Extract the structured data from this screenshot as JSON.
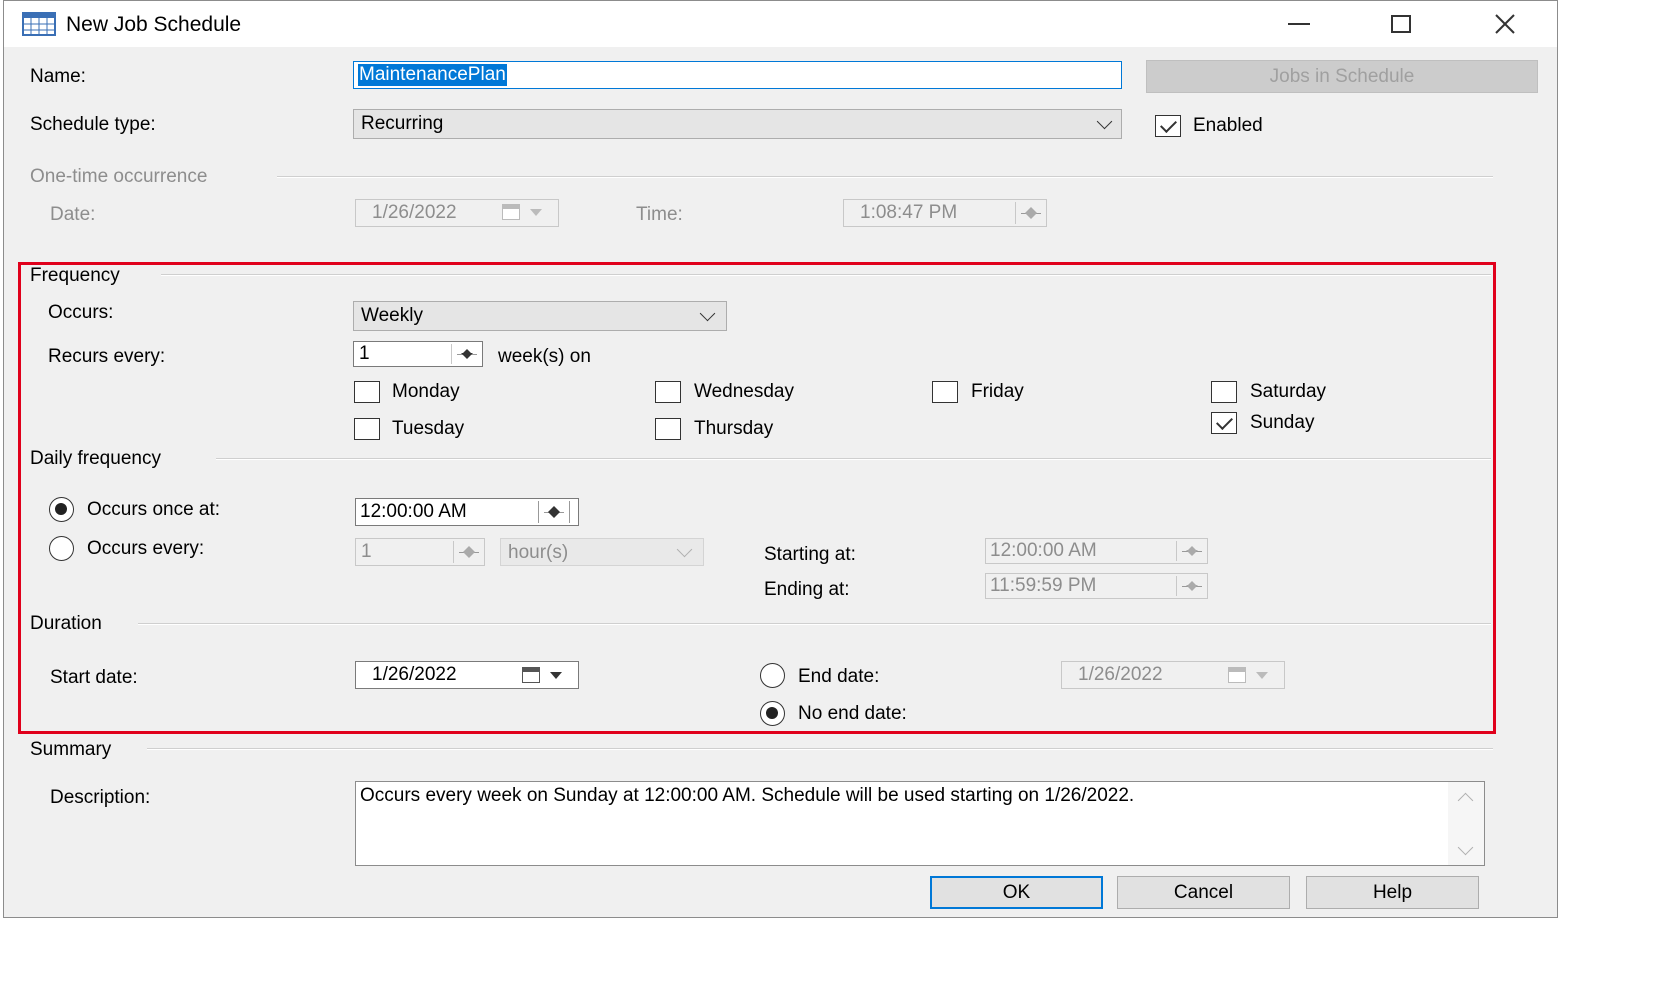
{
  "window": {
    "title": "New Job Schedule"
  },
  "name": {
    "label": "Name:",
    "value": "MaintenancePlan"
  },
  "jobs_button": "Jobs in Schedule",
  "schedule_type": {
    "label": "Schedule type:",
    "value": "Recurring"
  },
  "enabled": {
    "label": "Enabled",
    "checked": true
  },
  "one_time": {
    "header": "One-time occurrence",
    "date_label": "Date:",
    "date_value": "1/26/2022",
    "time_label": "Time:",
    "time_value": "1:08:47 PM"
  },
  "frequency": {
    "header": "Frequency",
    "occurs_label": "Occurs:",
    "occurs_value": "Weekly",
    "recurs_label": "Recurs every:",
    "recurs_value": "1",
    "recurs_unit": "week(s) on",
    "days": [
      {
        "label": "Monday",
        "checked": false
      },
      {
        "label": "Tuesday",
        "checked": false
      },
      {
        "label": "Wednesday",
        "checked": false
      },
      {
        "label": "Thursday",
        "checked": false
      },
      {
        "label": "Friday",
        "checked": false
      },
      {
        "label": "Saturday",
        "checked": false
      },
      {
        "label": "Sunday",
        "checked": true
      }
    ]
  },
  "daily": {
    "header": "Daily frequency",
    "once_label": "Occurs once at:",
    "once_value": "12:00:00 AM",
    "every_label": "Occurs every:",
    "every_value": "1",
    "every_unit": "hour(s)",
    "starting_label": "Starting at:",
    "starting_value": "12:00:00 AM",
    "ending_label": "Ending at:",
    "ending_value": "11:59:59 PM"
  },
  "duration": {
    "header": "Duration",
    "start_label": "Start date:",
    "start_value": "1/26/2022",
    "end_label": "End date:",
    "end_value": "1/26/2022",
    "noend_label": "No end date:"
  },
  "summary": {
    "header": "Summary",
    "desc_label": "Description:",
    "desc_value": "Occurs every week on Sunday at 12:00:00 AM. Schedule will be used starting on 1/26/2022."
  },
  "buttons": {
    "ok": "OK",
    "cancel": "Cancel",
    "help": "Help"
  },
  "colors": {
    "highlight_box": "#e0001b",
    "selection": "#0078d7",
    "window_bg": "#f0f0f0"
  }
}
